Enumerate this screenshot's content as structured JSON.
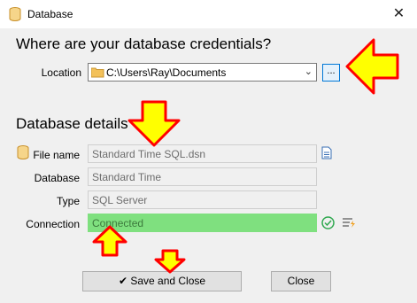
{
  "window": {
    "title": "Database",
    "close_glyph": "✕"
  },
  "credentials": {
    "heading": "Where are your database credentials?",
    "location_label": "Location",
    "location_value": "C:\\Users\\Ray\\Documents",
    "browse_label": "..."
  },
  "details": {
    "heading": "Database details",
    "file_name_label": "File name",
    "file_name_value": "Standard Time SQL.dsn",
    "database_label": "Database",
    "database_value": "Standard Time",
    "type_label": "Type",
    "type_value": "SQL Server",
    "connection_label": "Connection",
    "connection_value": "Connected"
  },
  "buttons": {
    "save_label": "Save and Close",
    "close_label": "Close"
  },
  "colors": {
    "accent": "#0078d7",
    "connected": "#7fe07f",
    "annotation_fill": "#ffff00",
    "annotation_stroke": "#ff0000"
  },
  "icons": [
    "database-icon",
    "folder-icon",
    "document-icon",
    "check-circle-icon",
    "connection-settings-icon",
    "checkmark-icon"
  ]
}
